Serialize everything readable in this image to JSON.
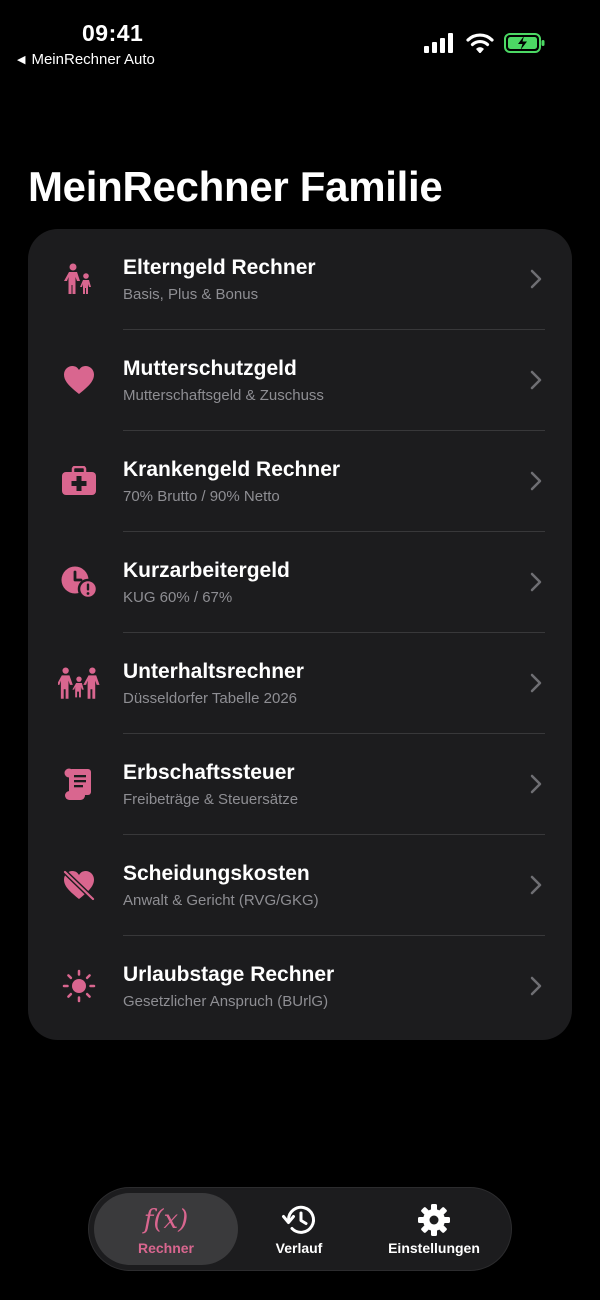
{
  "status_bar": {
    "time": "09:41",
    "back_app": "MeinRechner Auto",
    "back_icon": "back-triangle-icon"
  },
  "page": {
    "title": "MeinRechner Familie"
  },
  "accent_color": "#d9668f",
  "items": [
    {
      "title": "Elterngeld Rechner",
      "subtitle": "Basis, Plus & Bonus",
      "icon": "parent-child-icon"
    },
    {
      "title": "Mutterschutzgeld",
      "subtitle": "Mutterschaftsgeld & Zuschuss",
      "icon": "heart-icon"
    },
    {
      "title": "Krankengeld Rechner",
      "subtitle": "70% Brutto / 90% Netto",
      "icon": "medical-kit-icon"
    },
    {
      "title": "Kurzarbeitergeld",
      "subtitle": "KUG 60% / 67%",
      "icon": "clock-alert-icon"
    },
    {
      "title": "Unterhaltsrechner",
      "subtitle": "Düsseldorfer Tabelle 2026",
      "icon": "family-icon"
    },
    {
      "title": "Erbschaftssteuer",
      "subtitle": "Freibeträge & Steuersätze",
      "icon": "scroll-icon"
    },
    {
      "title": "Scheidungskosten",
      "subtitle": "Anwalt & Gericht (RVG/GKG)",
      "icon": "broken-heart-icon"
    },
    {
      "title": "Urlaubstage Rechner",
      "subtitle": "Gesetzlicher Anspruch (BUrlG)",
      "icon": "sun-icon"
    }
  ],
  "tabbar": {
    "tabs": [
      {
        "label": "Rechner",
        "icon": "function-icon",
        "symbol": "f(x)",
        "active": true
      },
      {
        "label": "Verlauf",
        "icon": "history-icon",
        "active": false
      },
      {
        "label": "Einstellungen",
        "icon": "gear-icon",
        "active": false
      }
    ]
  }
}
